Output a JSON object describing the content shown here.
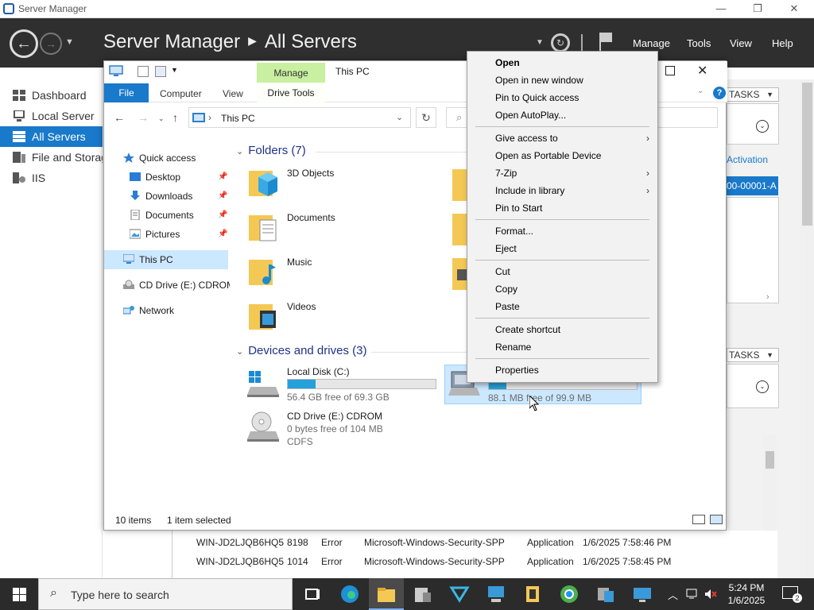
{
  "server_manager": {
    "window_title": "Server Manager",
    "breadcrumb_app": "Server Manager",
    "breadcrumb_page": "All Servers",
    "menu": [
      "Manage",
      "Tools",
      "View",
      "Help"
    ],
    "sidebar": [
      {
        "label": "Dashboard",
        "icon": "dashboard-icon"
      },
      {
        "label": "Local Server",
        "icon": "local-server-icon"
      },
      {
        "label": "All Servers",
        "icon": "all-servers-icon",
        "active": true
      },
      {
        "label": "File and Storag",
        "icon": "file-storage-icon"
      },
      {
        "label": "IIS",
        "icon": "iis-icon"
      }
    ],
    "tasks_label": "TASKS",
    "activation_link": "Activation",
    "selected_row_text": "00-00001-A",
    "events": [
      {
        "server": "WIN-JD2LJQB6HQ5",
        "id": "8198",
        "severity": "Error",
        "source": "Microsoft-Windows-Security-SPP",
        "log": "Application",
        "date": "1/6/2025 7:58:46 PM"
      },
      {
        "server": "WIN-JD2LJQB6HQ5",
        "id": "1014",
        "severity": "Error",
        "source": "Microsoft-Windows-Security-SPP",
        "log": "Application",
        "date": "1/6/2025 7:58:45 PM"
      }
    ]
  },
  "explorer": {
    "title": "This PC",
    "context_tab": "Manage",
    "ribbon_tabs": [
      "File",
      "Computer",
      "View"
    ],
    "drive_tools_tab": "Drive Tools",
    "address": "This PC",
    "nav_pane": {
      "quick_access": "Quick access",
      "pinned": [
        "Desktop",
        "Downloads",
        "Documents",
        "Pictures"
      ],
      "this_pc": "This PC",
      "cd_drive": "CD Drive (E:) CDROM",
      "network": "Network"
    },
    "folders_header": "Folders (7)",
    "folders": [
      "3D Objects",
      "Documents",
      "Music",
      "Videos"
    ],
    "devices_header": "Devices and drives (3)",
    "drives": [
      {
        "name": "Local Disk (C:)",
        "free_text": "56.4 GB free of 69.3 GB",
        "used_fraction": 0.19
      },
      {
        "name": "CD Drive (E:) CDROM",
        "free_text": "0 bytes free of 104 MB",
        "fs": "CDFS"
      },
      {
        "name": "",
        "free_text": "88.1 MB free of 99.9 MB",
        "used_fraction": 0.12
      }
    ],
    "status": {
      "items": "10 items",
      "selected": "1 item selected"
    }
  },
  "context_menu": {
    "items": [
      {
        "label": "Open",
        "bold": true
      },
      {
        "label": "Open in new window"
      },
      {
        "label": "Pin to Quick access"
      },
      {
        "label": "Open AutoPlay..."
      },
      {
        "label": "Give access to",
        "submenu": true
      },
      {
        "label": "Open as Portable Device"
      },
      {
        "label": "7-Zip",
        "submenu": true
      },
      {
        "label": "Include in library",
        "submenu": true
      },
      {
        "label": "Pin to Start"
      },
      {
        "label": "Format..."
      },
      {
        "label": "Eject"
      },
      {
        "label": "Cut"
      },
      {
        "label": "Copy"
      },
      {
        "label": "Paste"
      },
      {
        "label": "Create shortcut"
      },
      {
        "label": "Rename"
      },
      {
        "label": "Properties"
      }
    ]
  },
  "taskbar": {
    "search_placeholder": "Type here to search",
    "time": "5:24 PM",
    "date": "1/6/2025",
    "notification_count": "2",
    "apps": [
      "task-view-icon",
      "edge-icon",
      "file-explorer-icon",
      "server-manager-icon",
      "visual-studio-icon",
      "network-app-icon",
      "notepad-icon",
      "chrome-icon",
      "setup-icon",
      "remote-desktop-icon"
    ]
  },
  "colors": {
    "accent": "#1979ca",
    "header_bg": "#2f2f2f",
    "taskbar_bg": "#2b2b2b",
    "selection": "#cce8ff",
    "drive_bar": "#26a0da"
  }
}
